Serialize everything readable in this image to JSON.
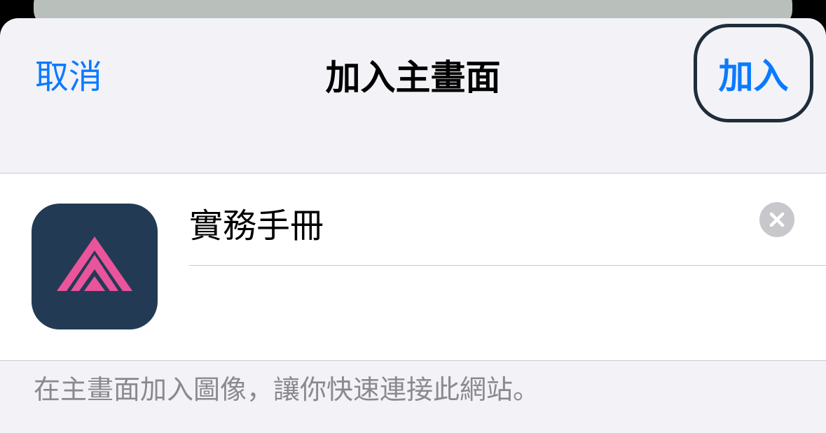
{
  "nav": {
    "cancel_label": "取消",
    "title": "加入主畫面",
    "add_label": "加入"
  },
  "form": {
    "name_value": "實務手冊",
    "clear_icon": "close-icon",
    "app_icon": {
      "icon": "stacked-triangle-logo",
      "background_color": "#233a55",
      "mark_color": "#e9549a"
    }
  },
  "footer": {
    "hint": "在主畫面加入圖像，讓你快速連接此網站。"
  },
  "colors": {
    "accent": "#0a7aff",
    "sheet_background": "#f2f2f7",
    "secondary_text": "#8a8a8e"
  }
}
